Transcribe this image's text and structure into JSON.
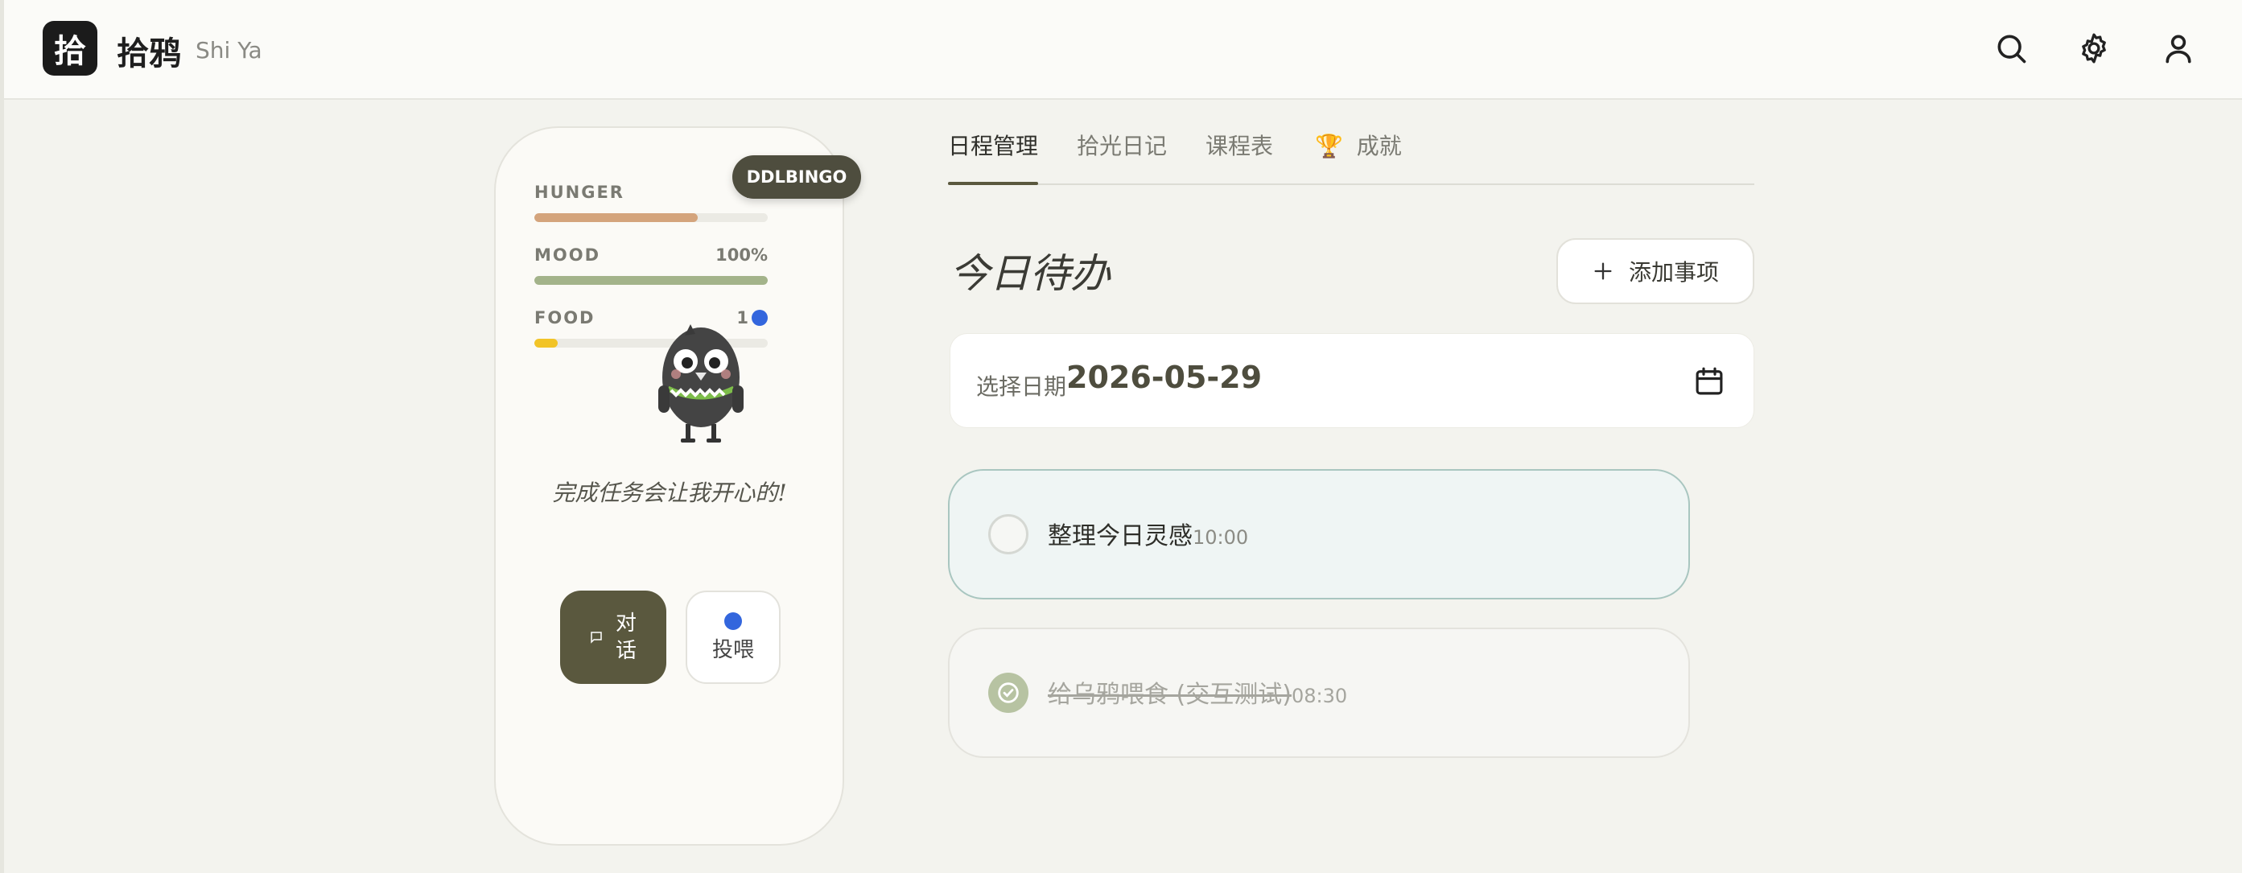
{
  "app": {
    "logo_char": "拾",
    "name": "拾鸦",
    "subtitle": "Shi Ya"
  },
  "header_icons": [
    "search-icon",
    "gear-icon",
    "user-icon"
  ],
  "pet": {
    "badge": "DDLBINGO",
    "stats": [
      {
        "label": "HUNGER",
        "value": "70",
        "fill": 0.7,
        "color": "#d4a47c"
      },
      {
        "label": "MOOD",
        "value": "100%",
        "fill": 1.0,
        "color": "#a3b38a"
      },
      {
        "label": "FOOD",
        "value": "1",
        "fill": 0.1,
        "color": "#f2c427",
        "icon": "blue-berry-icon"
      }
    ],
    "message": "完成任务会让我开心的!",
    "chat_button": "对话",
    "feed_button": "投喂"
  },
  "tabs": [
    {
      "label": "日程管理",
      "active": true
    },
    {
      "label": "拾光日记",
      "active": false
    },
    {
      "label": "课程表",
      "active": false
    },
    {
      "label": "成就",
      "active": false,
      "icon": "trophy-icon"
    }
  ],
  "main": {
    "title": "今日待办",
    "add_button": "添加事项",
    "date_label": "选择日期",
    "date_value": "2026-05-29"
  },
  "tasks": [
    {
      "title": "整理今日灵感",
      "time": "10:00",
      "done": false
    },
    {
      "title": "给乌鸦喂食 (交互测试)",
      "time": "08:30",
      "done": true
    }
  ],
  "colors": {
    "accent": "#5a583e",
    "background": "#f3f3ee",
    "pending_task_bg": "#eff5f4"
  }
}
